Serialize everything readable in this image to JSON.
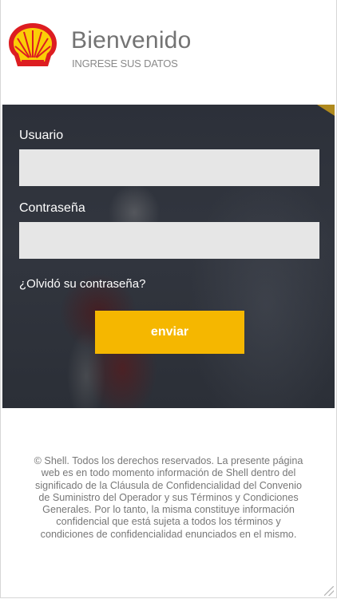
{
  "header": {
    "title": "Bienvenido",
    "subtitle": "INGRESE SUS DATOS",
    "logo_icon": "shell-logo-icon"
  },
  "form": {
    "username_label": "Usuario",
    "username_value": "",
    "password_label": "Contraseña",
    "password_value": "",
    "forgot_link": "¿Olvidó su contraseña?",
    "submit_label": "enviar"
  },
  "footer": {
    "text": "© Shell. Todos los derechos reservados. La presente página web es en todo momento información de Shell dentro del significado de la Cláusula de Confidencialidad del Convenio de Suministro del Operador y sus Términos y Condiciones Generales. Por lo tanto, la misma constituye información confidencial que está sujeta a todos los términos y condiciones de confidencialidad enunciados en el mismo."
  },
  "colors": {
    "accent": "#f5b700",
    "hero_background": "#2f333c",
    "input_background": "#e6e6e6",
    "shell_red": "#dd1d21",
    "shell_yellow": "#fbce07"
  }
}
